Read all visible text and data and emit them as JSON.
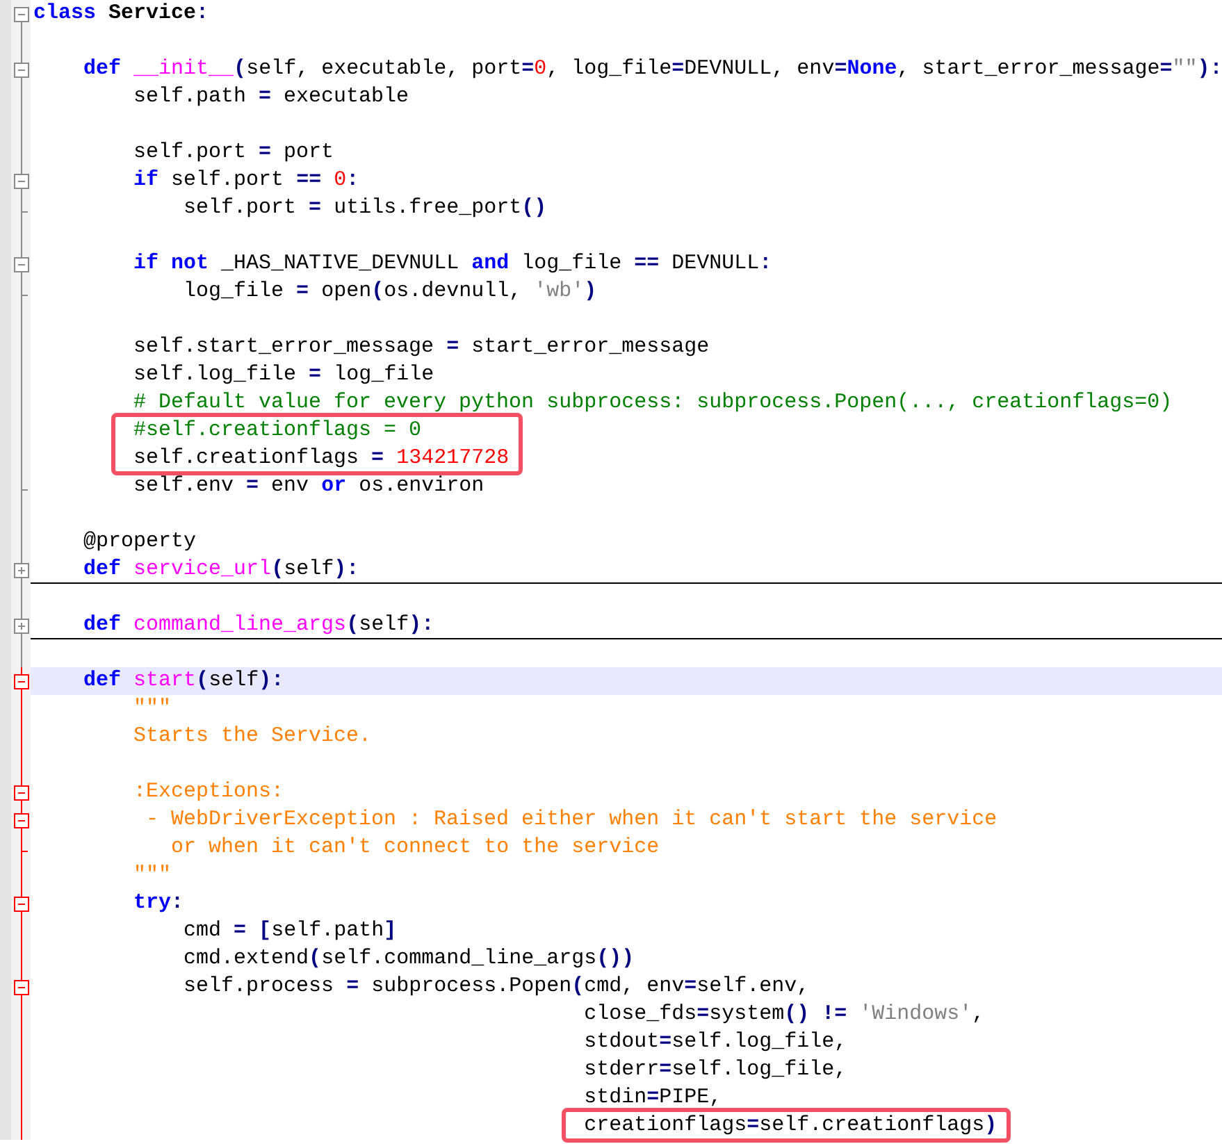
{
  "editor": {
    "lines": [
      {
        "kind": "open",
        "active": false,
        "current": false,
        "boxed": false,
        "segments": [
          {
            "kind": "kw",
            "text": "class"
          },
          {
            "kind": "cls",
            "text": " Service"
          },
          {
            "kind": "op",
            "text": ":"
          }
        ]
      },
      {
        "kind": "plain",
        "active": false,
        "current": false,
        "boxed": false
      },
      {
        "kind": "open",
        "active": false,
        "current": false,
        "boxed": false,
        "segments": [
          {
            "kind": "kw",
            "text": "    def"
          },
          {
            "kind": "name",
            "text": " __init__"
          },
          {
            "kind": "op",
            "text": "("
          },
          {
            "kind": "plain",
            "text": "self, executable, port"
          },
          {
            "kind": "op",
            "text": "="
          },
          {
            "kind": "num",
            "text": "0"
          },
          {
            "kind": "plain",
            "text": ", log_file"
          },
          {
            "kind": "op",
            "text": "="
          },
          {
            "kind": "plain",
            "text": "DEVNULL, env"
          },
          {
            "kind": "op",
            "text": "="
          },
          {
            "kind": "kw",
            "text": "None"
          },
          {
            "kind": "plain",
            "text": ", start_error_message"
          },
          {
            "kind": "op",
            "text": "="
          },
          {
            "kind": "str",
            "text": "\"\""
          },
          {
            "kind": "op",
            "text": "):"
          }
        ]
      },
      {
        "kind": "plain",
        "active": false,
        "current": false,
        "boxed": false,
        "segments": [
          {
            "kind": "plain",
            "text": "        self.path "
          },
          {
            "kind": "op",
            "text": "="
          },
          {
            "kind": "plain",
            "text": " executable"
          }
        ]
      },
      {
        "kind": "plain",
        "active": false,
        "current": false,
        "boxed": false
      },
      {
        "kind": "plain",
        "active": false,
        "current": false,
        "boxed": false,
        "segments": [
          {
            "kind": "plain",
            "text": "        self.port "
          },
          {
            "kind": "op",
            "text": "="
          },
          {
            "kind": "plain",
            "text": " port"
          }
        ]
      },
      {
        "kind": "open",
        "active": false,
        "current": false,
        "boxed": false,
        "segments": [
          {
            "kind": "kw",
            "text": "        if"
          },
          {
            "kind": "plain",
            "text": " self.port "
          },
          {
            "kind": "op",
            "text": "== "
          },
          {
            "kind": "num",
            "text": "0"
          },
          {
            "kind": "op",
            "text": ":"
          }
        ]
      },
      {
        "kind": "end",
        "active": false,
        "current": false,
        "boxed": false,
        "segments": [
          {
            "kind": "plain",
            "text": "            self.port "
          },
          {
            "kind": "op",
            "text": "="
          },
          {
            "kind": "plain",
            "text": " utils.free_port"
          },
          {
            "kind": "op",
            "text": "()"
          }
        ]
      },
      {
        "kind": "plain",
        "active": false,
        "current": false,
        "boxed": false
      },
      {
        "kind": "open",
        "active": false,
        "current": false,
        "boxed": false,
        "segments": [
          {
            "kind": "kw",
            "text": "        if"
          },
          {
            "kind": "kw",
            "text": " not"
          },
          {
            "kind": "plain",
            "text": " _HAS_NATIVE_DEVNULL "
          },
          {
            "kind": "kw",
            "text": "and"
          },
          {
            "kind": "plain",
            "text": " log_file "
          },
          {
            "kind": "op",
            "text": "=="
          },
          {
            "kind": "plain",
            "text": " DEVNULL"
          },
          {
            "kind": "op",
            "text": ":"
          }
        ]
      },
      {
        "kind": "end",
        "active": false,
        "current": false,
        "boxed": false,
        "segments": [
          {
            "kind": "plain",
            "text": "            log_file "
          },
          {
            "kind": "op",
            "text": "="
          },
          {
            "kind": "plain",
            "text": " open"
          },
          {
            "kind": "op",
            "text": "("
          },
          {
            "kind": "plain",
            "text": "os.devnull, "
          },
          {
            "kind": "str",
            "text": "'wb'"
          },
          {
            "kind": "op",
            "text": ")"
          }
        ]
      },
      {
        "kind": "plain",
        "active": false,
        "current": false,
        "boxed": false
      },
      {
        "kind": "plain",
        "active": false,
        "current": false,
        "boxed": false,
        "segments": [
          {
            "kind": "plain",
            "text": "        self.start_error_message "
          },
          {
            "kind": "op",
            "text": "="
          },
          {
            "kind": "plain",
            "text": " start_error_message"
          }
        ]
      },
      {
        "kind": "plain",
        "active": false,
        "current": false,
        "boxed": false,
        "segments": [
          {
            "kind": "plain",
            "text": "        self.log_file "
          },
          {
            "kind": "op",
            "text": "="
          },
          {
            "kind": "plain",
            "text": " log_file"
          }
        ]
      },
      {
        "kind": "plain",
        "active": false,
        "current": false,
        "boxed": false,
        "segments": [
          {
            "kind": "comment",
            "text": "        # Default value for every python subprocess: subprocess.Popen(..., creationflags=0)"
          }
        ]
      },
      {
        "kind": "plain",
        "active": false,
        "current": false,
        "boxed": true,
        "segments": [
          {
            "kind": "comment",
            "text": "        #self.creationflags = 0"
          }
        ]
      },
      {
        "kind": "plain",
        "active": false,
        "current": false,
        "boxed": true,
        "segments": [
          {
            "kind": "plain",
            "text": "        self.creationflags "
          },
          {
            "kind": "op",
            "text": "= "
          },
          {
            "kind": "num",
            "text": "134217728"
          }
        ]
      },
      {
        "kind": "end",
        "active": false,
        "current": false,
        "boxed": false,
        "segments": [
          {
            "kind": "plain",
            "text": "        self.env "
          },
          {
            "kind": "op",
            "text": "="
          },
          {
            "kind": "plain",
            "text": " env "
          },
          {
            "kind": "kw",
            "text": "or"
          },
          {
            "kind": "plain",
            "text": " os.environ"
          }
        ]
      },
      {
        "kind": "plain",
        "active": false,
        "current": false,
        "boxed": false
      },
      {
        "kind": "plain",
        "active": false,
        "current": false,
        "boxed": false,
        "segments": [
          {
            "kind": "plain",
            "text": "    @property"
          }
        ]
      },
      {
        "kind": "collapsed",
        "active": false,
        "current": false,
        "boxed": false,
        "segments": [
          {
            "kind": "kw",
            "text": "    def"
          },
          {
            "kind": "name",
            "text": " service_url"
          },
          {
            "kind": "op",
            "text": "("
          },
          {
            "kind": "plain",
            "text": "self"
          },
          {
            "kind": "op",
            "text": "):"
          }
        ]
      },
      {
        "kind": "plain",
        "active": false,
        "current": false,
        "boxed": false
      },
      {
        "kind": "collapsed",
        "active": false,
        "current": false,
        "boxed": false,
        "segments": [
          {
            "kind": "kw",
            "text": "    def"
          },
          {
            "kind": "name",
            "text": " command_line_args"
          },
          {
            "kind": "op",
            "text": "("
          },
          {
            "kind": "plain",
            "text": "self"
          },
          {
            "kind": "op",
            "text": "):"
          }
        ]
      },
      {
        "kind": "plain",
        "active": false,
        "current": false,
        "boxed": false
      },
      {
        "kind": "open",
        "active": true,
        "current": true,
        "boxed": false,
        "segments": [
          {
            "kind": "kw",
            "text": "    def"
          },
          {
            "kind": "name",
            "text": " start"
          },
          {
            "kind": "op",
            "text": "("
          },
          {
            "kind": "plain",
            "text": "self"
          },
          {
            "kind": "op",
            "text": "):"
          }
        ]
      },
      {
        "kind": "plain",
        "active": true,
        "current": false,
        "boxed": false,
        "segments": [
          {
            "kind": "doc",
            "text": "        \"\"\""
          }
        ]
      },
      {
        "kind": "plain",
        "active": true,
        "current": false,
        "boxed": false,
        "segments": [
          {
            "kind": "doc",
            "text": "        Starts the Service."
          }
        ]
      },
      {
        "kind": "plain",
        "active": true,
        "current": false,
        "boxed": false
      },
      {
        "kind": "open",
        "active": true,
        "current": false,
        "boxed": false,
        "segments": [
          {
            "kind": "doc",
            "text": "        :Exceptions:"
          }
        ]
      },
      {
        "kind": "open",
        "active": true,
        "current": false,
        "boxed": false,
        "segments": [
          {
            "kind": "doc",
            "text": "         - WebDriverException : Raised either when it can't start the service"
          }
        ]
      },
      {
        "kind": "end",
        "active": true,
        "current": false,
        "boxed": false,
        "segments": [
          {
            "kind": "doc",
            "text": "           or when it can't connect to the service"
          }
        ]
      },
      {
        "kind": "plain",
        "active": true,
        "current": false,
        "boxed": false,
        "segments": [
          {
            "kind": "doc",
            "text": "        \"\"\""
          }
        ]
      },
      {
        "kind": "open",
        "active": true,
        "current": false,
        "boxed": false,
        "segments": [
          {
            "kind": "kw",
            "text": "        try"
          },
          {
            "kind": "op",
            "text": ":"
          }
        ]
      },
      {
        "kind": "plain",
        "active": true,
        "current": false,
        "boxed": false,
        "segments": [
          {
            "kind": "plain",
            "text": "            cmd "
          },
          {
            "kind": "op",
            "text": "= ["
          },
          {
            "kind": "plain",
            "text": "self.path"
          },
          {
            "kind": "op",
            "text": "]"
          }
        ]
      },
      {
        "kind": "plain",
        "active": true,
        "current": false,
        "boxed": false,
        "segments": [
          {
            "kind": "plain",
            "text": "            cmd.extend"
          },
          {
            "kind": "op",
            "text": "("
          },
          {
            "kind": "plain",
            "text": "self.command_line_args"
          },
          {
            "kind": "op",
            "text": "())"
          }
        ]
      },
      {
        "kind": "open",
        "active": true,
        "current": false,
        "boxed": false,
        "segments": [
          {
            "kind": "plain",
            "text": "            self.process "
          },
          {
            "kind": "op",
            "text": "="
          },
          {
            "kind": "plain",
            "text": " subprocess.Popen"
          },
          {
            "kind": "op",
            "text": "("
          },
          {
            "kind": "plain",
            "text": "cmd, env"
          },
          {
            "kind": "op",
            "text": "="
          },
          {
            "kind": "plain",
            "text": "self.env,"
          }
        ]
      },
      {
        "kind": "plain",
        "active": true,
        "current": false,
        "boxed": false,
        "segments": [
          {
            "kind": "plain",
            "text": "                                            close_fds"
          },
          {
            "kind": "op",
            "text": "="
          },
          {
            "kind": "plain",
            "text": "system"
          },
          {
            "kind": "op",
            "text": "() != "
          },
          {
            "kind": "str",
            "text": "'Windows'"
          },
          {
            "kind": "plain",
            "text": ","
          }
        ]
      },
      {
        "kind": "plain",
        "active": true,
        "current": false,
        "boxed": false,
        "segments": [
          {
            "kind": "plain",
            "text": "                                            stdout"
          },
          {
            "kind": "op",
            "text": "="
          },
          {
            "kind": "plain",
            "text": "self.log_file,"
          }
        ]
      },
      {
        "kind": "plain",
        "active": true,
        "current": false,
        "boxed": false,
        "segments": [
          {
            "kind": "plain",
            "text": "                                            stderr"
          },
          {
            "kind": "op",
            "text": "="
          },
          {
            "kind": "plain",
            "text": "self.log_file,"
          }
        ]
      },
      {
        "kind": "plain",
        "active": true,
        "current": false,
        "boxed": false,
        "segments": [
          {
            "kind": "plain",
            "text": "                                            stdin"
          },
          {
            "kind": "op",
            "text": "="
          },
          {
            "kind": "plain",
            "text": "PIPE,"
          }
        ]
      },
      {
        "kind": "plain",
        "active": true,
        "current": false,
        "boxed": true,
        "segments": [
          {
            "kind": "plain",
            "text": "                                            creationflags"
          },
          {
            "kind": "op",
            "text": "="
          },
          {
            "kind": "plain",
            "text": "self.creationflags"
          },
          {
            "kind": "op",
            "text": ")"
          }
        ]
      }
    ]
  }
}
